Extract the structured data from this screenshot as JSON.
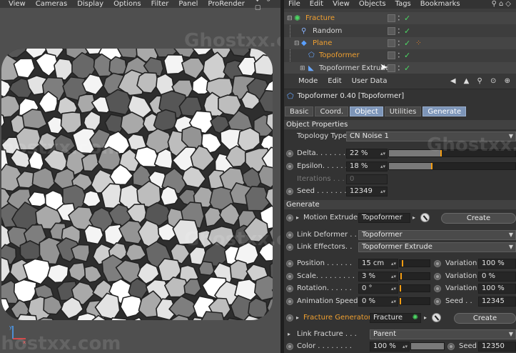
{
  "viewport": {
    "menu": [
      "View",
      "Cameras",
      "Display",
      "Options",
      "Filter",
      "Panel",
      "ProRender"
    ],
    "axis": {
      "y": "y",
      "x": "x"
    }
  },
  "object_manager": {
    "menu": [
      "File",
      "Edit",
      "View",
      "Objects",
      "Tags",
      "Bookmarks"
    ],
    "objects": [
      {
        "name": "Fracture",
        "color": "#f0a030",
        "icon": "voronoi-fracture-icon"
      },
      {
        "name": "Random",
        "color": "#d8d8d8",
        "icon": "random-effector-icon"
      },
      {
        "name": "Plane",
        "color": "#f0a030",
        "icon": "plane-icon"
      },
      {
        "name": "Topoformer",
        "color": "#f0a030",
        "icon": "topoformer-icon"
      },
      {
        "name": "Topoformer Extrude",
        "color": "#d8d8d8",
        "icon": "extrude-icon"
      }
    ]
  },
  "attribute_manager": {
    "menu": [
      "Mode",
      "Edit",
      "User Data"
    ],
    "title": "Topoformer 0.40 [Topoformer]",
    "tabs": [
      {
        "label": "Basic",
        "active": false
      },
      {
        "label": "Coord.",
        "active": false
      },
      {
        "label": "Object",
        "active": true
      },
      {
        "label": "Utilities",
        "active": false
      },
      {
        "label": "Generate",
        "active": true
      }
    ],
    "object_properties": {
      "header": "Object Properties",
      "topology_type": {
        "label": "Topology Type",
        "value": "CN Noise 1"
      },
      "delta": {
        "label": "Delta. . . . . . . .",
        "value": "22 %",
        "fraction": 0.22
      },
      "epsilon": {
        "label": "Epsilon. . . . . .",
        "value": "18 %",
        "fraction": 0.18
      },
      "iterations": {
        "label": "Iterations . . . .",
        "value": "0"
      },
      "seed": {
        "label": "Seed . . . . . . . .",
        "value": "12349"
      }
    },
    "generate": {
      "header": "Generate",
      "motion_extrude": {
        "label": "Motion Extrude",
        "value": "Topoformer",
        "button": "Create"
      },
      "link_deformer": {
        "label": "Link Deformer . .",
        "value": "Topoformer"
      },
      "link_effectors": {
        "label": "Link Effectors. .",
        "value": "Topoformer Extrude"
      },
      "position": {
        "label": "Position . . . . . .",
        "value": "15 cm",
        "variation_label": "Variation",
        "variation": "100 %"
      },
      "scale": {
        "label": "Scale. . . . . . . . .",
        "value": "3 %",
        "variation_label": "Variation",
        "variation": "0 %"
      },
      "rotation": {
        "label": "Rotation. . . . . .",
        "value": "0 °",
        "variation_label": "Variation",
        "variation": "100 %"
      },
      "animation_speed": {
        "label": "Animation Speed",
        "value": "0 %",
        "seed_label": "Seed . .",
        "seed": "12345"
      },
      "fracture_generator": {
        "label": "Fracture Generator",
        "value": "Fracture",
        "button": "Create"
      },
      "link_fracture": {
        "label": "Link Fracture . . .",
        "value": "Parent"
      },
      "color": {
        "label": "Color . . . . . . . .",
        "value": "100 %",
        "seed_label": "Seed",
        "seed": "12350"
      }
    }
  },
  "watermarks": [
    "Ghostxx.com",
    "Ghostxx.com",
    "Ghostxx.com",
    "Ghostxx.com",
    "Ghostxx.com"
  ]
}
